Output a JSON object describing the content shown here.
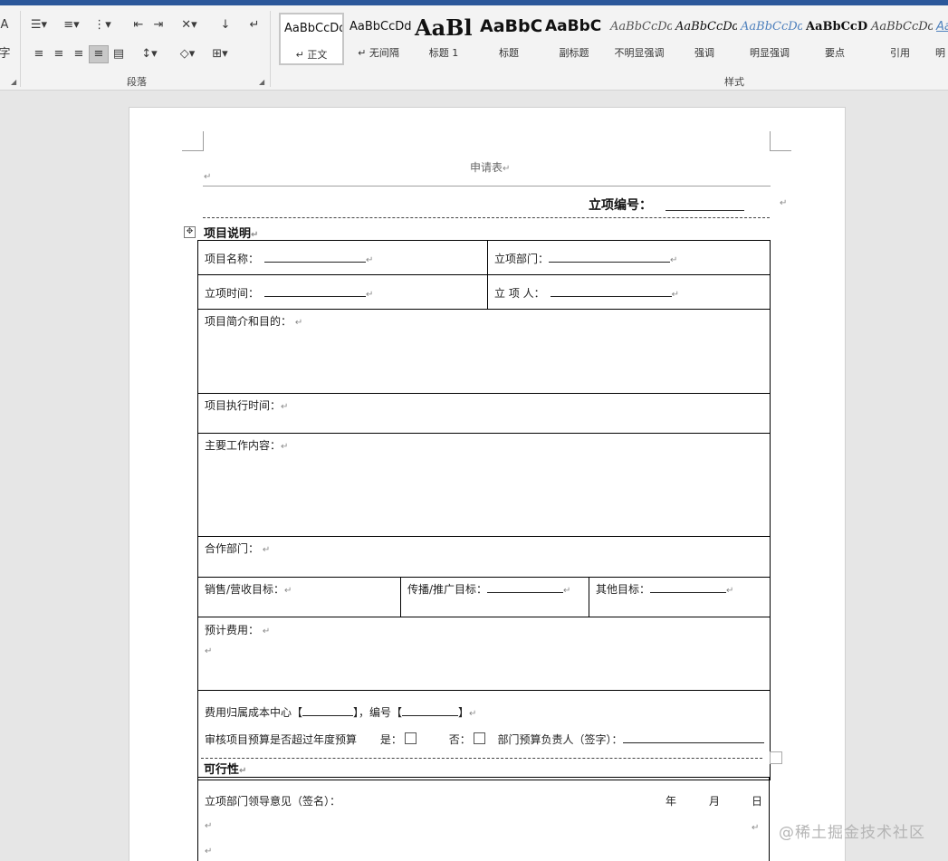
{
  "ribbon": {
    "paragraph_group": "段落",
    "styles_group": "样式",
    "styles": [
      {
        "sample": "AaBbCcDd",
        "name": "↵ 正文"
      },
      {
        "sample": "AaBbCcDd",
        "name": "↵ 无间隔"
      },
      {
        "sample": "AaBl",
        "name": "标题 1"
      },
      {
        "sample": "AaBbC",
        "name": "标题"
      },
      {
        "sample": "AaBbC",
        "name": "副标题"
      },
      {
        "sample": "AaBbCcDd",
        "name": "不明显强调"
      },
      {
        "sample": "AaBbCcDd",
        "name": "强调"
      },
      {
        "sample": "AaBbCcDd",
        "name": "明显强调"
      },
      {
        "sample": "AaBbCcD",
        "name": "要点"
      },
      {
        "sample": "AaBbCcDd",
        "name": "引用"
      },
      {
        "sample": "Aa",
        "name": "明"
      }
    ]
  },
  "document": {
    "header_title": "申请表",
    "project_no_label": "立项编号：",
    "section1_title": "项目说明",
    "project_name_label": "项目名称：",
    "dept_label": "立项部门：",
    "time_label": "立项时间：",
    "person_label": "立 项 人：",
    "intro_label": "项目简介和目的：",
    "exec_time_label": "项目执行时间：",
    "main_work_label": "主要工作内容：",
    "coop_dept_label": "合作部门：",
    "sales_target_label": "销售/营收目标：",
    "promo_target_label": "传播/推广目标：",
    "other_target_label": "其他目标：",
    "budget_label": "预计费用：",
    "cost_center_label": "费用归属成本中心【",
    "cost_center_number_label": "】，编号【",
    "cost_center_end": "】",
    "over_budget_label": "审核项目预算是否超过年度预算",
    "yes_label": "是：",
    "no_label": "否：",
    "budget_owner_label": "部门预算负责人（签字）：",
    "section2_title": "可行性",
    "leader_opinion_label": "立项部门领导意见（签名）：",
    "year_label": "年",
    "month_label": "月",
    "day_label": "日"
  },
  "watermark": "@稀土掘金技术社区"
}
